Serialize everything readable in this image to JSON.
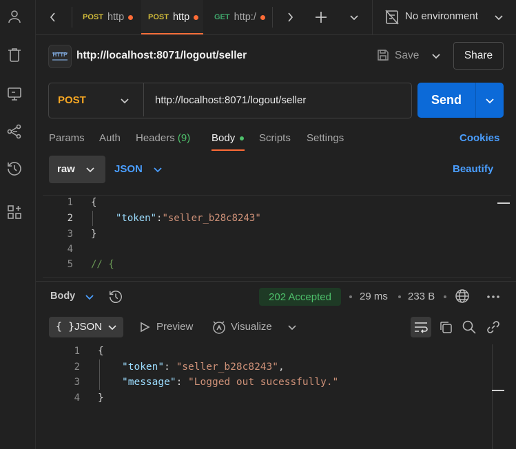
{
  "tabs": [
    {
      "method": "POST",
      "title": "http",
      "method_color": "#cfb93a",
      "active": false
    },
    {
      "method": "POST",
      "title": "http",
      "method_color": "#cfb93a",
      "active": true
    },
    {
      "method": "GET",
      "title": "http:/",
      "method_color": "#3fa66b",
      "active": false
    }
  ],
  "environment": "No environment",
  "request": {
    "title": "http://localhost:8071/logout/seller",
    "http_badge": "HTTP",
    "save_label": "Save",
    "share_label": "Share",
    "method": "POST",
    "url": "http://localhost:8071/logout/seller",
    "send_label": "Send"
  },
  "request_tabs": {
    "params": "Params",
    "auth": "Auth",
    "headers": "Headers",
    "headers_count": "(9)",
    "body": "Body",
    "scripts": "Scripts",
    "settings": "Settings",
    "cookies": "Cookies"
  },
  "body_options": {
    "mode": "raw",
    "format": "JSON",
    "beautify": "Beautify"
  },
  "request_body": {
    "line_numbers": [
      "1",
      "2",
      "3",
      "4",
      "5"
    ],
    "brace_open": "{",
    "key": "\"token\"",
    "colon": ":",
    "value": "\"seller_b28c8243\"",
    "brace_close": "}",
    "comment": "// {"
  },
  "response": {
    "label": "Body",
    "status": "202 Accepted",
    "time": "29 ms",
    "size": "233 B",
    "view_format": "JSON",
    "view_format_icon": "{ }",
    "preview": "Preview",
    "visualize": "Visualize",
    "line_numbers": [
      "1",
      "2",
      "3",
      "4"
    ],
    "brace_open": "{",
    "token_key": "\"token\"",
    "token_value": "\"seller_b28c8243\"",
    "message_key": "\"message\"",
    "message_value": "\"Logged out sucessfully.\"",
    "brace_close": "}"
  },
  "colors": {
    "accent": "#ff6c37",
    "send": "#0c6ad8",
    "link": "#4a9eff",
    "json_key": "#9cdcfe",
    "json_string": "#ce9178",
    "status_ok": "#4ec06b"
  },
  "icons": [
    "user-icon",
    "trash-icon",
    "monitor-icon",
    "flow-icon",
    "history-icon",
    "apps-icon",
    "chevron-left-icon",
    "chevron-right-icon",
    "plus-icon",
    "chevron-down-icon",
    "no-environment-icon",
    "save-icon",
    "globe-icon",
    "more-icon",
    "wrap-icon",
    "copy-icon",
    "search-icon",
    "link-icon",
    "play-icon",
    "visualize-icon"
  ]
}
